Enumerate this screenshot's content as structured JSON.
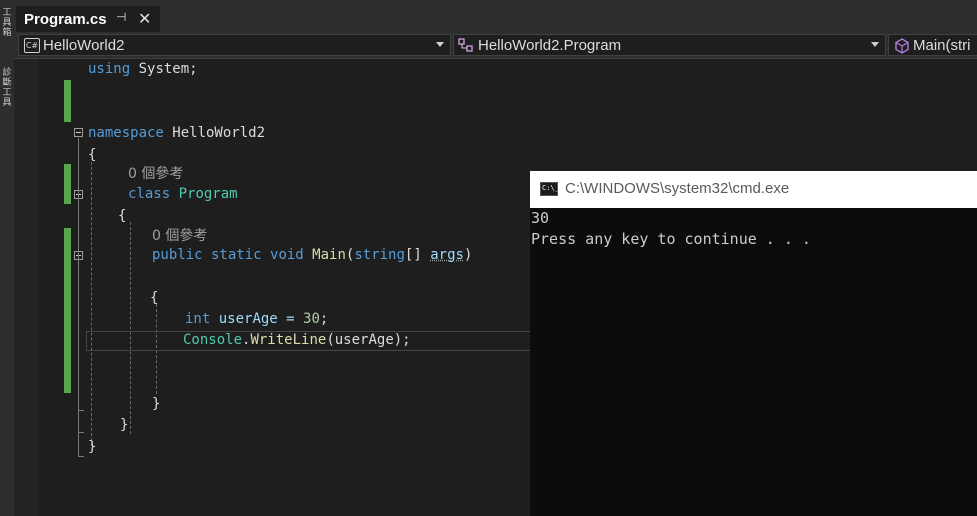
{
  "left_panel": {
    "labels": [
      "工",
      "具",
      "箱",
      "診",
      "斷",
      "工",
      "具"
    ]
  },
  "tab": {
    "title": "Program.cs",
    "pin_glyph": "⊣",
    "close_glyph": "✕"
  },
  "navbar": {
    "project": "HelloWorld2",
    "class": "HelloWorld2.Program",
    "member": "Main(stri"
  },
  "code": {
    "using_kw": "using",
    "using_ns": " System;",
    "namespace_kw": "namespace",
    "namespace_name": " HelloWorld2",
    "open_brace_ns": "{",
    "ref_class": "0 個參考",
    "class_kw": "class",
    "class_name": " Program",
    "open_brace_class": "{",
    "ref_main": "0 個參考",
    "public_kw": "public",
    "static_kw": " static",
    "void_kw": " void",
    "main_name": " Main",
    "main_open": "(",
    "string_kw": "string",
    "main_mid": "[] ",
    "args_name": "args",
    "main_close": ")",
    "open_brace_main": "{",
    "int_kw": "int",
    "user_age_decl": " userAge = ",
    "age_value": "30",
    "semicolon": ";",
    "console_type": "Console",
    "dot": ".",
    "writeline": "WriteLine",
    "writeline_args": "(userAge);",
    "close_brace_main": "}",
    "close_brace_class": "}",
    "close_brace_ns": "}"
  },
  "console": {
    "title": "C:\\WINDOWS\\system32\\cmd.exe",
    "icon_text": "C:\\_",
    "output": [
      "30",
      "Press any key to continue . . ."
    ]
  },
  "colors": {
    "keyword": "#569cd6",
    "type": "#4ec9b0",
    "method": "#dcdcaa",
    "param": "#9cdcfe",
    "number": "#b5cea8",
    "change_marker": "#57a64a"
  }
}
